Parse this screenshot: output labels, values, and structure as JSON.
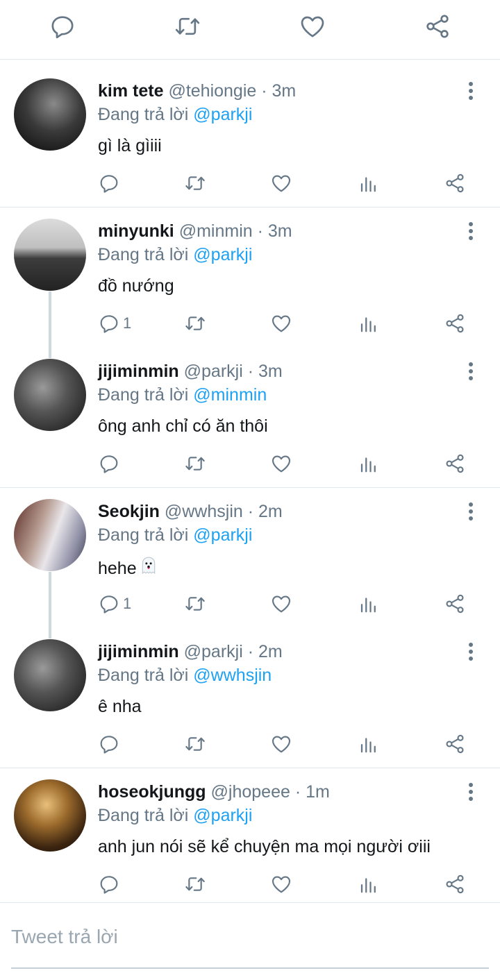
{
  "colors": {
    "accent": "#1da1f2",
    "muted": "#657786",
    "icon": "#657786",
    "divider": "#e1e8ed"
  },
  "topbar": {
    "icons": [
      "reply-icon",
      "retweet-icon",
      "like-icon",
      "share-icon"
    ]
  },
  "reply_label": "Đang trả lời",
  "tweets": [
    {
      "name": "kim tete",
      "handle": "@tehiongie",
      "time": "· 3m",
      "reply_to": "@parkji",
      "text": "gì là gìiii",
      "reply_count": ""
    },
    {
      "name": "minyunki",
      "handle": "@minmin",
      "time": "· 3m",
      "reply_to": "@parkji",
      "text": "đồ nướng",
      "reply_count": "1"
    },
    {
      "name": "jijiminmin",
      "handle": "@parkji",
      "time": "· 3m",
      "reply_to": "@minmin",
      "text": "ông anh chỉ có ăn thôi",
      "reply_count": ""
    },
    {
      "name": "Seokjin",
      "handle": "@wwhsjin",
      "time": "· 2m",
      "reply_to": "@parkji",
      "text": "hehe",
      "emoji": "ghost-emoji",
      "reply_count": "1"
    },
    {
      "name": "jijiminmin",
      "handle": "@parkji",
      "time": "· 2m",
      "reply_to": "@wwhsjin",
      "text": "ê nha",
      "reply_count": ""
    },
    {
      "name": "hoseokjungg",
      "handle": "@jhopeee",
      "time": "· 1m",
      "reply_to": "@parkji",
      "text": "anh jun nói sẽ kể chuyện ma mọi người ơiii",
      "reply_count": ""
    }
  ],
  "compose": {
    "placeholder": "Tweet trả lời"
  }
}
